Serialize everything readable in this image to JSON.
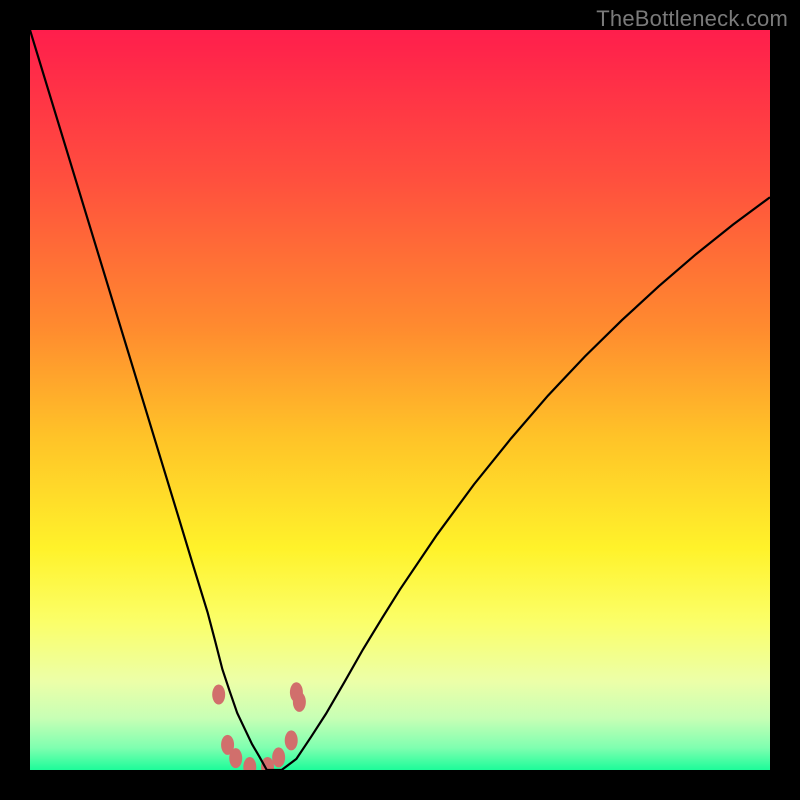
{
  "watermark": "TheBottleneck.com",
  "chart_data": {
    "type": "line",
    "title": "",
    "xlabel": "",
    "ylabel": "",
    "xlim": [
      0,
      100
    ],
    "ylim": [
      0,
      100
    ],
    "grid": false,
    "background": {
      "type": "vertical-gradient",
      "stops": [
        {
          "offset": 0.0,
          "color": "#ff1e4c"
        },
        {
          "offset": 0.2,
          "color": "#ff4f3e"
        },
        {
          "offset": 0.4,
          "color": "#ff8a2f"
        },
        {
          "offset": 0.55,
          "color": "#ffc328"
        },
        {
          "offset": 0.7,
          "color": "#fff22a"
        },
        {
          "offset": 0.8,
          "color": "#fbff69"
        },
        {
          "offset": 0.88,
          "color": "#ecffa8"
        },
        {
          "offset": 0.93,
          "color": "#c7ffb5"
        },
        {
          "offset": 0.97,
          "color": "#7fffb0"
        },
        {
          "offset": 1.0,
          "color": "#1dfc9a"
        }
      ]
    },
    "series": [
      {
        "name": "curve",
        "color": "#000000",
        "width": 2.2,
        "x": [
          0,
          2.5,
          5,
          7.5,
          10,
          12.5,
          15,
          17.5,
          20,
          22,
          24,
          25,
          26,
          27,
          28,
          29,
          30,
          31,
          32,
          34,
          36,
          38,
          40,
          42.5,
          45,
          47.5,
          50,
          55,
          60,
          65,
          70,
          75,
          80,
          85,
          90,
          95,
          100
        ],
        "y": [
          100,
          91.8,
          83.6,
          75.4,
          67.2,
          59,
          50.8,
          42.6,
          34.4,
          27.8,
          21.3,
          17.5,
          13.6,
          10.6,
          7.7,
          5.6,
          3.5,
          1.8,
          0.0,
          0.0,
          1.5,
          4.5,
          7.6,
          11.9,
          16.3,
          20.4,
          24.4,
          31.8,
          38.6,
          44.8,
          50.6,
          55.9,
          60.8,
          65.4,
          69.7,
          73.7,
          77.4
        ]
      }
    ],
    "markers": {
      "name": "dip-points",
      "color": "#d16f6c",
      "radius_x": 6.5,
      "radius_y": 10,
      "points": [
        {
          "x": 25.5,
          "y": 10.2
        },
        {
          "x": 26.7,
          "y": 3.4
        },
        {
          "x": 27.8,
          "y": 1.6
        },
        {
          "x": 29.7,
          "y": 0.4
        },
        {
          "x": 32.1,
          "y": 0.4
        },
        {
          "x": 33.6,
          "y": 1.7
        },
        {
          "x": 35.3,
          "y": 4.0
        },
        {
          "x": 36.0,
          "y": 10.5
        },
        {
          "x": 36.4,
          "y": 9.2
        }
      ]
    }
  }
}
